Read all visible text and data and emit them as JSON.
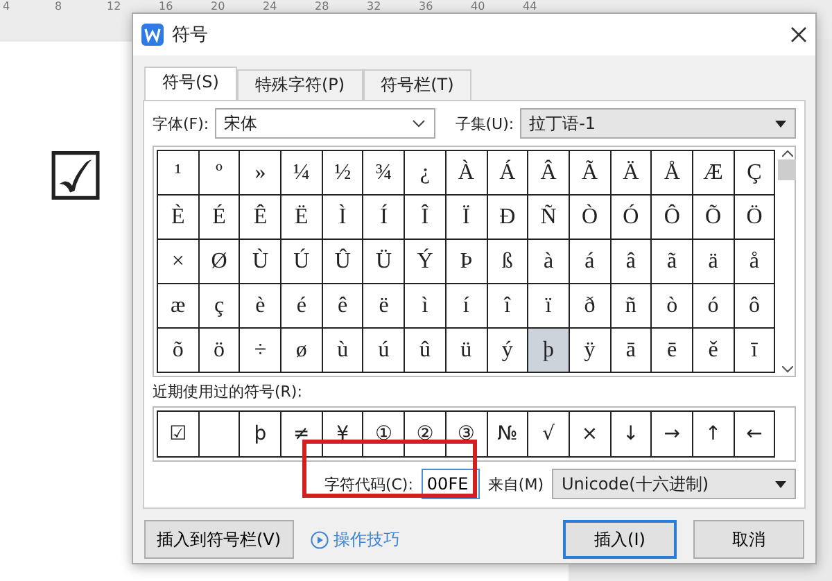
{
  "ruler": {
    "ticks": [
      "4",
      "8",
      "12",
      "16",
      "20",
      "24",
      "28",
      "32",
      "36",
      "40",
      "44"
    ]
  },
  "document": {
    "symbol": "☑"
  },
  "dialog": {
    "title": "符号",
    "tabs": [
      {
        "label": "符号(S)",
        "selected": true
      },
      {
        "label": "特殊字符(P)",
        "selected": false
      },
      {
        "label": "符号栏(T)",
        "selected": false
      }
    ],
    "font_label": "字体(F):",
    "font_value": "宋体",
    "subset_label": "子集(U):",
    "subset_value": "拉丁语-1",
    "symbols": [
      [
        {
          "char": "¹",
          "selected": false
        },
        {
          "char": "º",
          "selected": false
        },
        {
          "char": "»",
          "selected": false
        },
        {
          "char": "¼",
          "selected": false
        },
        {
          "char": "½",
          "selected": false
        },
        {
          "char": "¾",
          "selected": false
        },
        {
          "char": "¿",
          "selected": false
        },
        {
          "char": "À",
          "selected": false
        },
        {
          "char": "Á",
          "selected": false
        },
        {
          "char": "Â",
          "selected": false
        },
        {
          "char": "Ã",
          "selected": false
        },
        {
          "char": "Ä",
          "selected": false
        },
        {
          "char": "Å",
          "selected": false
        },
        {
          "char": "Æ",
          "selected": false
        },
        {
          "char": "Ç",
          "selected": false
        }
      ],
      [
        {
          "char": "È",
          "selected": false
        },
        {
          "char": "É",
          "selected": false
        },
        {
          "char": "Ê",
          "selected": false
        },
        {
          "char": "Ë",
          "selected": false
        },
        {
          "char": "Ì",
          "selected": false
        },
        {
          "char": "Í",
          "selected": false
        },
        {
          "char": "Î",
          "selected": false
        },
        {
          "char": "Ï",
          "selected": false
        },
        {
          "char": "Ð",
          "selected": false
        },
        {
          "char": "Ñ",
          "selected": false
        },
        {
          "char": "Ò",
          "selected": false
        },
        {
          "char": "Ó",
          "selected": false
        },
        {
          "char": "Ô",
          "selected": false
        },
        {
          "char": "Õ",
          "selected": false
        },
        {
          "char": "Ö",
          "selected": false
        }
      ],
      [
        {
          "char": "×",
          "selected": false
        },
        {
          "char": "Ø",
          "selected": false
        },
        {
          "char": "Ù",
          "selected": false
        },
        {
          "char": "Ú",
          "selected": false
        },
        {
          "char": "Û",
          "selected": false
        },
        {
          "char": "Ü",
          "selected": false
        },
        {
          "char": "Ý",
          "selected": false
        },
        {
          "char": "Þ",
          "selected": false
        },
        {
          "char": "ß",
          "selected": false
        },
        {
          "char": "à",
          "selected": false
        },
        {
          "char": "á",
          "selected": false
        },
        {
          "char": "â",
          "selected": false
        },
        {
          "char": "ã",
          "selected": false
        },
        {
          "char": "ä",
          "selected": false
        },
        {
          "char": "å",
          "selected": false
        }
      ],
      [
        {
          "char": "æ",
          "selected": false
        },
        {
          "char": "ç",
          "selected": false
        },
        {
          "char": "è",
          "selected": false
        },
        {
          "char": "é",
          "selected": false
        },
        {
          "char": "ê",
          "selected": false
        },
        {
          "char": "ë",
          "selected": false
        },
        {
          "char": "ì",
          "selected": false
        },
        {
          "char": "í",
          "selected": false
        },
        {
          "char": "î",
          "selected": false
        },
        {
          "char": "ï",
          "selected": false
        },
        {
          "char": "ð",
          "selected": false
        },
        {
          "char": "ñ",
          "selected": false
        },
        {
          "char": "ò",
          "selected": false
        },
        {
          "char": "ó",
          "selected": false
        },
        {
          "char": "ô",
          "selected": false
        }
      ],
      [
        {
          "char": "õ",
          "selected": false
        },
        {
          "char": "ö",
          "selected": false
        },
        {
          "char": "÷",
          "selected": false
        },
        {
          "char": "ø",
          "selected": false
        },
        {
          "char": "ù",
          "selected": false
        },
        {
          "char": "ú",
          "selected": false
        },
        {
          "char": "û",
          "selected": false
        },
        {
          "char": "ü",
          "selected": false
        },
        {
          "char": "ý",
          "selected": false
        },
        {
          "char": "þ",
          "selected": true
        },
        {
          "char": "ÿ",
          "selected": false
        },
        {
          "char": "ā",
          "selected": false
        },
        {
          "char": "ē",
          "selected": false
        },
        {
          "char": "ě",
          "selected": false
        },
        {
          "char": "ī",
          "selected": false
        }
      ]
    ],
    "recent_label": "近期使用过的符号(R):",
    "recent": [
      {
        "kind": "symbol",
        "char": "☑"
      },
      {
        "kind": "blank"
      },
      {
        "kind": "symbol",
        "char": "þ"
      },
      {
        "kind": "symbol",
        "char": "≠"
      },
      {
        "kind": "symbol",
        "char": "¥"
      },
      {
        "kind": "symbol",
        "char": "①"
      },
      {
        "kind": "symbol",
        "char": "②"
      },
      {
        "kind": "symbol",
        "char": "③"
      },
      {
        "kind": "symbol",
        "char": "№"
      },
      {
        "kind": "symbol",
        "char": "√"
      },
      {
        "kind": "symbol",
        "char": "×"
      },
      {
        "kind": "symbol",
        "char": "↓"
      },
      {
        "kind": "symbol",
        "char": "→"
      },
      {
        "kind": "symbol",
        "char": "↑"
      },
      {
        "kind": "symbol",
        "char": "←"
      }
    ],
    "code_label": "字符代码(C):",
    "code_value": "00FE",
    "from_label": "来自(M)",
    "from_value": "Unicode(十六进制)",
    "add_to_bar": "插入到符号栏(V)",
    "tips_link": "操作技巧",
    "insert": "插入(I)",
    "cancel": "取消"
  }
}
